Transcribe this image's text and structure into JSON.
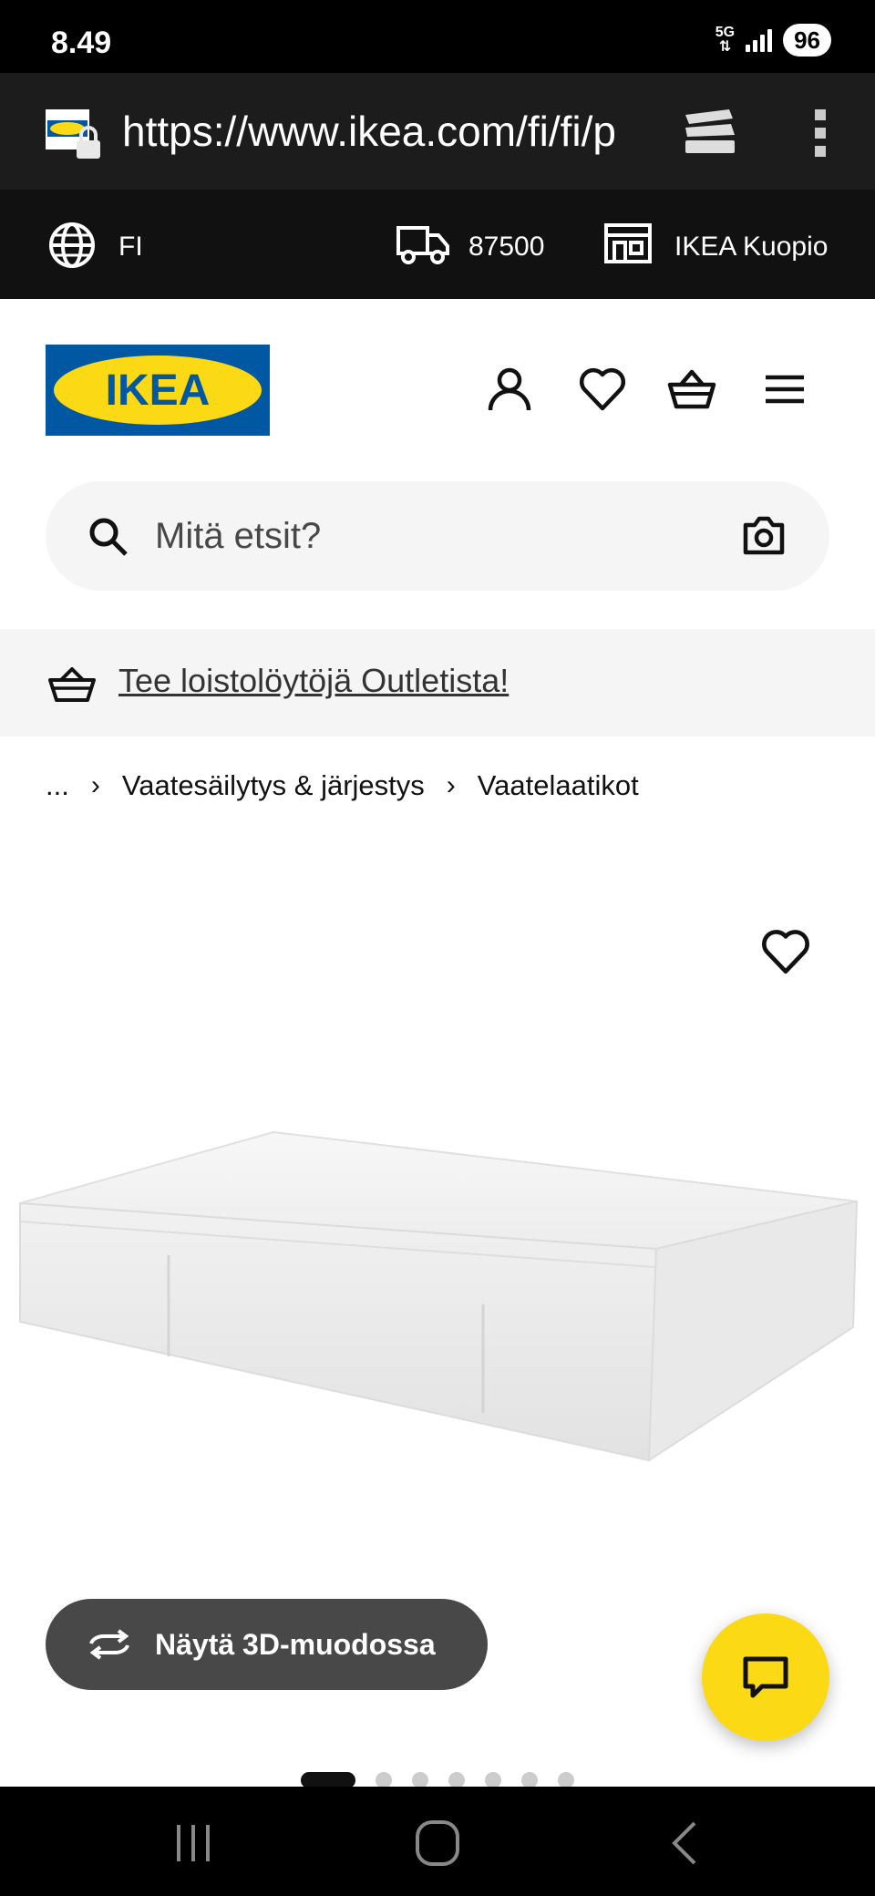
{
  "status_bar": {
    "time": "8.49",
    "network": "5G",
    "battery": "96"
  },
  "browser": {
    "url": "https://www.ikea.com/fi/fi/p",
    "icons": [
      "site-lock-icon",
      "tabs-icon",
      "more-vertical-icon"
    ]
  },
  "topbar": {
    "language": "FI",
    "postal_code": "87500",
    "store": "IKEA Kuopio"
  },
  "header": {
    "logo_text": "IKEA",
    "brand_colors": {
      "blue": "#0058a3",
      "yellow": "#fbd914"
    }
  },
  "search": {
    "placeholder": "Mitä etsit?"
  },
  "promo": {
    "text": "Tee loistolöytöjä Outletista!"
  },
  "breadcrumb": {
    "ellipsis": "...",
    "items": [
      "Vaatesäilytys & järjestys",
      "Vaatelaatikot"
    ]
  },
  "product": {
    "view_3d_label": "Näytä 3D-muodossa",
    "image_count": 7,
    "active_image": 1
  }
}
